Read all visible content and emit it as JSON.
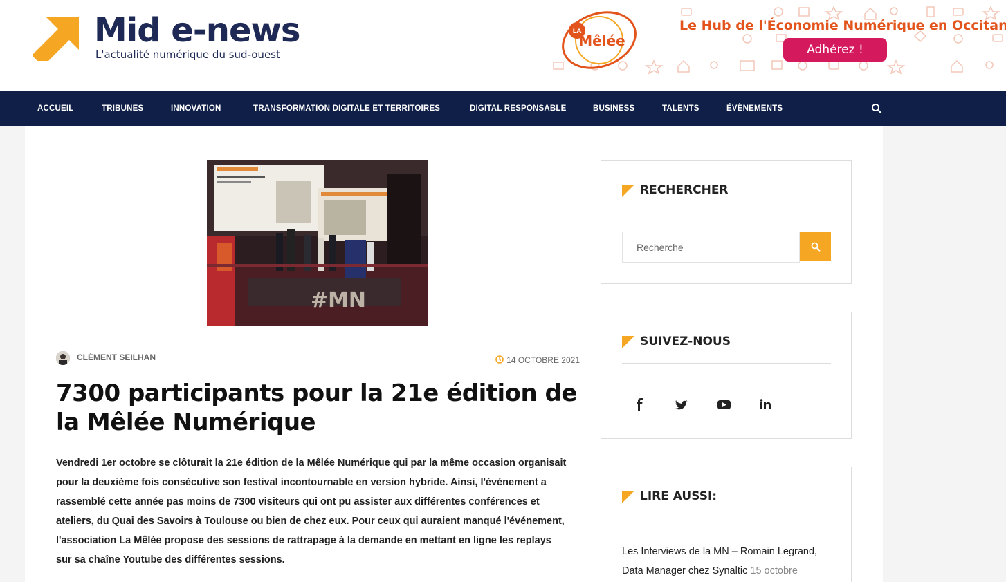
{
  "header": {
    "logo_title": "Mid e-news",
    "logo_tagline": "L'actualité numérique du sud-ouest",
    "banner": {
      "headline": "Le Hub de l'Économie Numérique en Occitanie",
      "cta": "Adhérez !",
      "logo_text": "Mêlée",
      "logo_prefix": "LA"
    }
  },
  "nav": {
    "items": [
      {
        "label": "ACCUEIL"
      },
      {
        "label": "TRIBUNES"
      },
      {
        "label": "INNOVATION"
      },
      {
        "label": "TRANSFORMATION DIGITALE ET TERRITOIRES"
      },
      {
        "label": "DIGITAL RESPONSABLE"
      },
      {
        "label": "BUSINESS"
      },
      {
        "label": "TALENTS"
      },
      {
        "label": "ÉVÈNEMENTS"
      }
    ],
    "search_icon": "search-icon"
  },
  "article": {
    "author": "CLÉMENT SEILHAN",
    "date": "14 OCTOBRE 2021",
    "title": "7300 participants pour la 21e édition de la Mêlée Numérique",
    "lede": "Vendredi 1er octobre se clôturait la 21e édition de la Mêlée Numérique qui par la même occasion organisait pour la deuxième fois consécutive son festival incontournable en version hybride. Ainsi, l'événement a rassemblé cette année pas moins de 7300 visiteurs qui ont pu assister aux différentes conférences et ateliers, du Quai des Savoirs à Toulouse ou bien de chez eux. Pour ceux qui auraient manqué l'événement, l'association La Mêlée propose des sessions de rattrapage à la demande en mettant en ligne les replays sur sa chaîne Youtube des différentes sessions."
  },
  "sidebar": {
    "search": {
      "title": "RECHERCHER",
      "placeholder": "Recherche"
    },
    "follow": {
      "title": "SUIVEZ-NOUS",
      "icons": [
        "facebook-icon",
        "twitter-icon",
        "youtube-icon",
        "linkedin-icon"
      ]
    },
    "read_also": {
      "title": "LIRE AUSSI:",
      "link_text": "Les Interviews de la MN – Romain Legrand, Data Manager chez Synaltic",
      "link_date": "15 octobre"
    }
  },
  "colors": {
    "navy": "#0f1f48",
    "accent": "#f5a623",
    "banner_orange": "#e2541c",
    "banner_pink": "#d4195d"
  }
}
